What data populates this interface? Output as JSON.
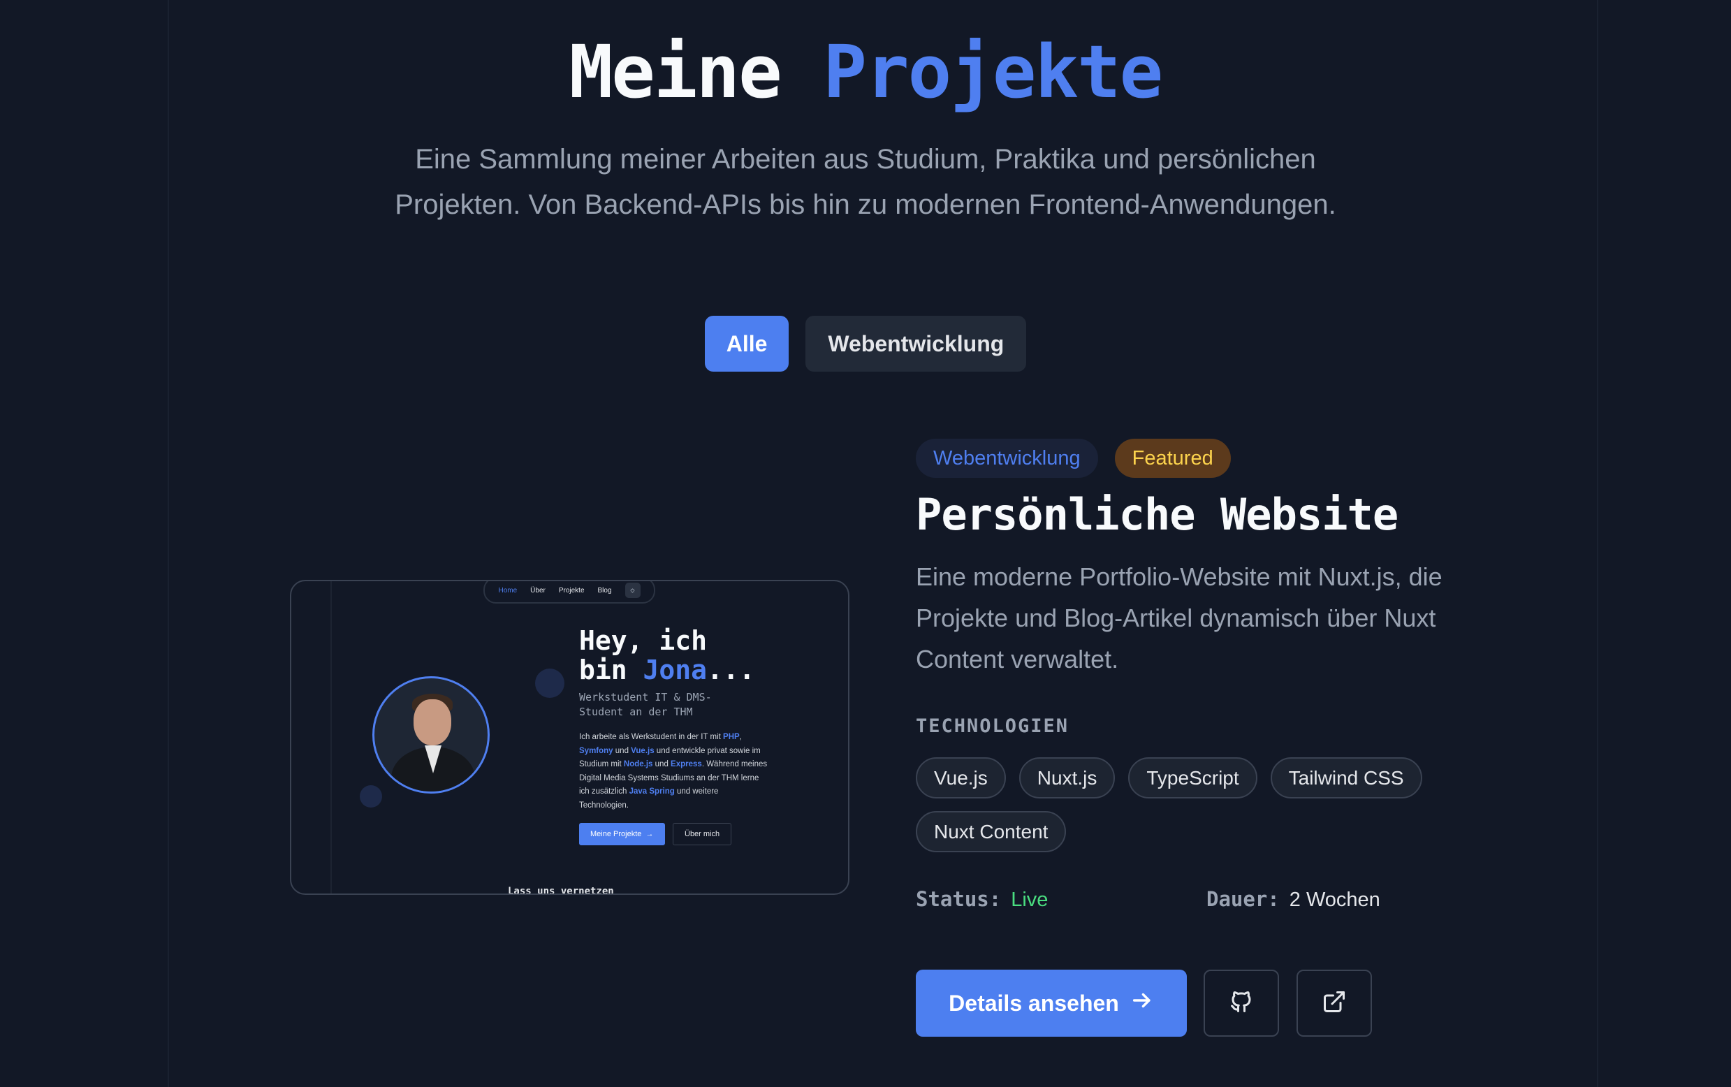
{
  "header": {
    "title_part1": "Meine",
    "title_part2": "Projekte",
    "subtitle": "Eine Sammlung meiner Arbeiten aus Studium, Praktika und persönlichen Projekten. Von Backend-APIs bis hin zu modernen Frontend-Anwendungen."
  },
  "filters": [
    {
      "label": "Alle",
      "active": true
    },
    {
      "label": "Webentwicklung",
      "active": false
    }
  ],
  "preview": {
    "nav": [
      "Home",
      "Über",
      "Projekte",
      "Blog"
    ],
    "hero_line1": "Hey, ich",
    "hero_line2_prefix": "bin ",
    "hero_name": "Jona",
    "hero_suffix": "...",
    "role": "Werkstudent IT & DMS-Student an der THM",
    "body_parts": {
      "p1": "Ich arbeite als Werkstudent in der IT mit ",
      "php": "PHP",
      "c1": ", ",
      "symfony": "Symfony",
      "und1": " und ",
      "vue": "Vue.js",
      "p2": " und entwickle privat sowie im Studium mit ",
      "node": "Node.js",
      "und2": " und ",
      "express": "Express",
      "p3": ". Während meines Digital Media Systems Studiums an der THM lerne ich zusätzlich ",
      "java": "Java Spring",
      "p4": " und weitere Technologien."
    },
    "btn_primary": "Meine Projekte",
    "btn_secondary": "Über mich",
    "footer": "Lass uns vernetzen"
  },
  "project": {
    "category_badge": "Webentwicklung",
    "featured_badge": "Featured",
    "title": "Persönliche Website",
    "description": "Eine moderne Portfolio-Website mit Nuxt.js, die Projekte und Blog-Artikel dynamisch über Nuxt Content verwaltet.",
    "tech_label": "TECHNOLOGIEN",
    "technologies": [
      "Vue.js",
      "Nuxt.js",
      "TypeScript",
      "Tailwind CSS",
      "Nuxt Content"
    ],
    "status_label": "Status:",
    "status_value": "Live",
    "duration_label": "Dauer:",
    "duration_value": "2 Wochen",
    "details_button": "Details ansehen"
  },
  "icons": {
    "details_arrow": "arrow-right-icon",
    "github": "github-icon",
    "external": "external-link-icon",
    "theme": "sun-icon"
  },
  "colors": {
    "background": "#121826",
    "accent": "#4d7ff0",
    "status_live": "#4ade80",
    "featured_bg": "#5c3a1c",
    "featured_text": "#fcd34d"
  }
}
